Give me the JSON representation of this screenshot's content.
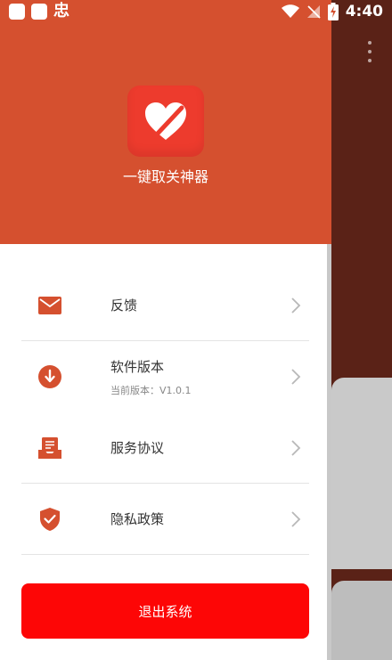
{
  "status_bar": {
    "app_glyph": "忠",
    "time": "4:40"
  },
  "drawer": {
    "app_name": "一键取关神器",
    "items": [
      {
        "label": "反馈",
        "subtitle": "",
        "icon": "mail-icon"
      },
      {
        "label": "软件版本",
        "subtitle": "当前版本：V1.0.1",
        "icon": "download-icon"
      },
      {
        "label": "服务协议",
        "subtitle": "",
        "icon": "agreement-icon"
      },
      {
        "label": "隐私政策",
        "subtitle": "",
        "icon": "shield-check-icon"
      }
    ],
    "logout_label": "退出系统"
  },
  "colors": {
    "header": "#d5502f",
    "accent": "#d5502f",
    "logout": "#fd0606",
    "logo": "#ed3b2d"
  }
}
